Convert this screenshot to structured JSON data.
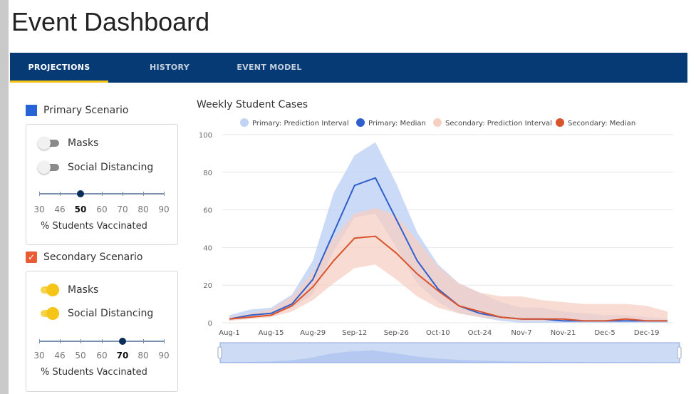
{
  "app_title": "Event Dashboard",
  "nav": {
    "tabs": [
      {
        "label": "PROJECTIONS",
        "active": true
      },
      {
        "label": "HISTORY",
        "active": false
      },
      {
        "label": "EVENT MODEL",
        "active": false
      }
    ]
  },
  "primary": {
    "title": "Primary Scenario",
    "color": "#2563d6",
    "toggles": [
      {
        "label": "Masks",
        "on": false
      },
      {
        "label": "Social Distancing",
        "on": false
      }
    ],
    "vaccination": {
      "ticks": [
        "30",
        "46",
        "50",
        "60",
        "70",
        "80",
        "90"
      ],
      "selected": "50",
      "caption": "% Students Vaccinated"
    }
  },
  "secondary": {
    "title": "Secondary Scenario",
    "checked": true,
    "color": "#e85b35",
    "toggles": [
      {
        "label": "Masks",
        "on": true
      },
      {
        "label": "Social Distancing",
        "on": true
      }
    ],
    "vaccination": {
      "ticks": [
        "30",
        "46",
        "50",
        "60",
        "70",
        "80",
        "90"
      ],
      "selected": "70",
      "caption": "% Students Vaccinated"
    }
  },
  "chart_data": {
    "type": "area",
    "title": "Weekly Student Cases",
    "xlabel": "",
    "ylabel": "",
    "ylim": [
      0,
      100
    ],
    "yticks": [
      0,
      20,
      40,
      60,
      80,
      100
    ],
    "grid": true,
    "legend_position": "top",
    "x": [
      "Aug-1",
      "Aug-8",
      "Aug-15",
      "Aug-22",
      "Aug-29",
      "Sep-5",
      "Sep-12",
      "Sep-19",
      "Sep-26",
      "Oct-3",
      "Oct-10",
      "Oct-17",
      "Oct-24",
      "Oct-31",
      "Nov-7",
      "Nov-14",
      "Nov-21",
      "Nov-28",
      "Dec-5",
      "Dec-12",
      "Dec-19",
      "Dec-26"
    ],
    "x_tick_labels": [
      "Aug-1",
      "Aug-15",
      "Aug-29",
      "Sep-12",
      "Sep-26",
      "Oct-10",
      "Oct-24",
      "Nov-7",
      "Nov-21",
      "Dec-5",
      "Dec-19"
    ],
    "series": [
      {
        "name": "Primary: Prediction Interval",
        "kind": "band",
        "color": "#c2d3f5",
        "lower": [
          1,
          4,
          4,
          8,
          15,
          38,
          56,
          58,
          40,
          21,
          11,
          5,
          3,
          1,
          0,
          0,
          0,
          0,
          0,
          0,
          0,
          0
        ],
        "upper": [
          4,
          7,
          8,
          15,
          33,
          69,
          89,
          96,
          74,
          48,
          31,
          21,
          16,
          11,
          8,
          8,
          6,
          5,
          4,
          4,
          3,
          2
        ]
      },
      {
        "name": "Primary: Median",
        "kind": "line",
        "color": "#2f5fcc",
        "values": [
          2,
          4,
          5,
          10,
          23,
          48,
          73,
          77,
          55,
          33,
          18,
          9,
          5,
          3,
          2,
          2,
          1,
          1,
          1,
          1,
          1,
          1
        ]
      },
      {
        "name": "Secondary: Prediction Interval",
        "kind": "band",
        "color": "#f6cfc3",
        "lower": [
          1,
          2,
          3,
          6,
          12,
          21,
          29,
          31,
          23,
          14,
          8,
          5,
          3,
          2,
          1,
          1,
          1,
          1,
          1,
          1,
          1,
          1
        ],
        "upper": [
          3,
          5,
          7,
          14,
          27,
          45,
          58,
          61,
          57,
          44,
          30,
          21,
          16,
          14,
          14,
          12,
          11,
          10,
          10,
          10,
          9,
          6
        ]
      },
      {
        "name": "Secondary: Median",
        "kind": "line",
        "color": "#d9532c",
        "values": [
          2,
          3,
          4,
          9,
          19,
          33,
          45,
          46,
          37,
          26,
          17,
          9,
          6,
          3,
          2,
          2,
          2,
          1,
          1,
          2,
          1,
          1
        ]
      }
    ]
  }
}
